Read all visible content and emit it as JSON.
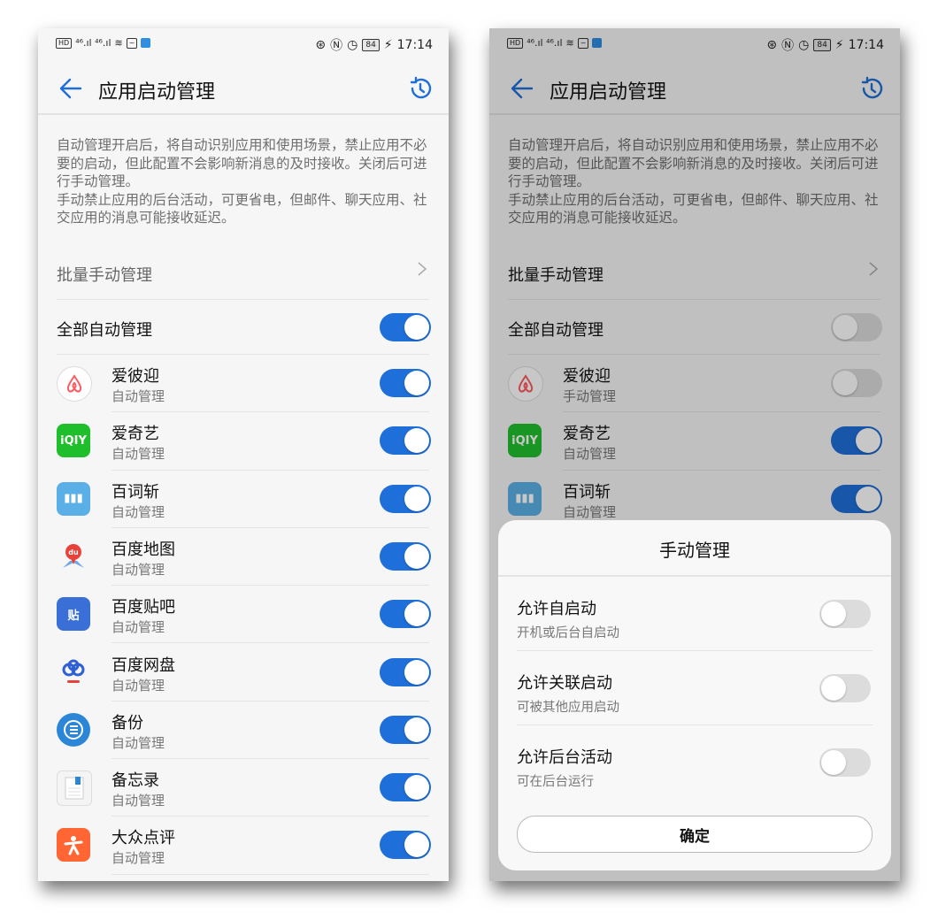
{
  "status_bar": {
    "time": "17:14",
    "battery": "84",
    "left_icons": "HD ⁴⁶.ıl ⁴⁶.ıl",
    "right_icons": [
      "alarm-icon",
      "nfc-icon",
      "clock-icon"
    ]
  },
  "title": "应用启动管理",
  "description": [
    "自动管理开启后，将自动识别应用和使用场景，禁止应用不必要的启动，但此配置不会影响新消息的及时接收。关闭后可进行手动管理。",
    "手动禁止应用的后台活动，可更省电，但邮件、聊天应用、社交应用的消息可能接收延迟。"
  ],
  "batch_manage": "批量手动管理",
  "all_auto": "全部自动管理",
  "colors": {
    "accent": "#1e6fd9",
    "toggle_off": "#dcdcdc"
  },
  "left_apps": [
    {
      "name": "爱彼迎",
      "status": "自动管理",
      "on": true
    },
    {
      "name": "爱奇艺",
      "status": "自动管理",
      "on": true
    },
    {
      "name": "百词斩",
      "status": "自动管理",
      "on": true
    },
    {
      "name": "百度地图",
      "status": "自动管理",
      "on": true
    },
    {
      "name": "百度贴吧",
      "status": "自动管理",
      "on": true
    },
    {
      "name": "百度网盘",
      "status": "自动管理",
      "on": true
    },
    {
      "name": "备份",
      "status": "自动管理",
      "on": true
    },
    {
      "name": "备忘录",
      "status": "自动管理",
      "on": true
    },
    {
      "name": "大众点评",
      "status": "自动管理",
      "on": true
    }
  ],
  "right_apps": [
    {
      "name": "爱彼迎",
      "status": "手动管理",
      "on": false
    },
    {
      "name": "爱奇艺",
      "status": "自动管理",
      "on": true
    },
    {
      "name": "百词斩",
      "status": "自动管理",
      "on": true
    }
  ],
  "dialog": {
    "title": "手动管理",
    "options": [
      {
        "label": "允许自启动",
        "sub": "开机或后台自启动",
        "on": false
      },
      {
        "label": "允许关联启动",
        "sub": "可被其他应用启动",
        "on": false
      },
      {
        "label": "允许后台活动",
        "sub": "可在后台运行",
        "on": false
      }
    ],
    "confirm": "确定"
  },
  "icon_glyphs": {
    "iqiyi": "iQIY",
    "baicizhan": "▮▮▮",
    "tieba": "贴",
    "dianping": "✕"
  }
}
